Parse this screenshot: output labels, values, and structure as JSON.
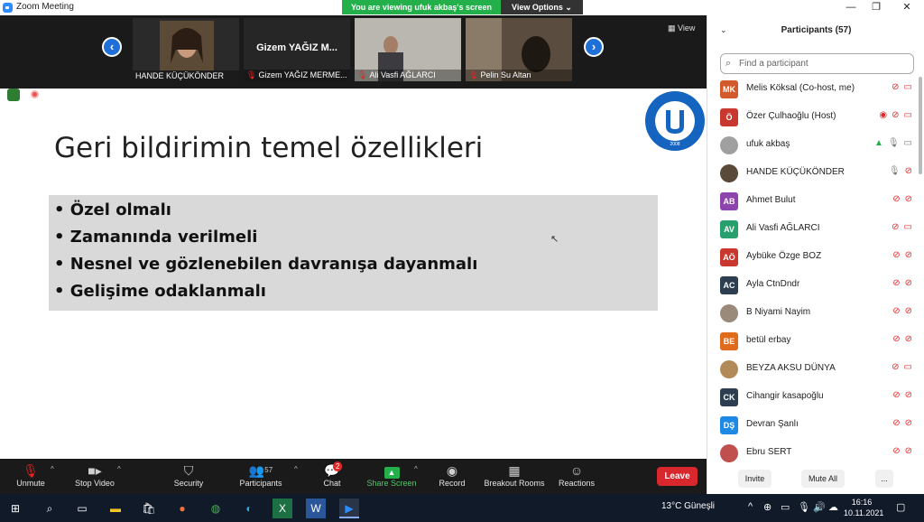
{
  "window": {
    "title": "Zoom Meeting",
    "minimize": "—",
    "maximize": "❐",
    "close": "✕"
  },
  "banner": {
    "message": "You are viewing ufuk akbaş's screen",
    "options": "View Options ⌄"
  },
  "video_strip": {
    "tiles": [
      {
        "name": "HANDE KÜÇÜKÖNDER",
        "muted": false
      },
      {
        "name": "Gizem YAĞIZ MERME...",
        "big_name": "Gizem YAĞIZ M...",
        "muted": true
      },
      {
        "name": "Ali Vasfi AĞLARCI",
        "muted": true
      },
      {
        "name": "Pelin Su Altan",
        "muted": true
      }
    ],
    "view_label": "View"
  },
  "slide": {
    "title": "Geri bildirimin temel özellikleri",
    "bullets": [
      "• Özel olmalı",
      "• Zamanında verilmeli",
      "• Nesnel ve gözlenebilen davranışa dayanmalı",
      "• Gelişime odaklanmalı"
    ],
    "logo_text": "BARTIN ÜNİVERSİTESİ",
    "logo_year": "2008"
  },
  "toolbar": {
    "unmute": "Unmute",
    "stop_video": "Stop Video",
    "security": "Security",
    "participants": "Participants",
    "participants_count": "57",
    "chat": "Chat",
    "chat_badge": "2",
    "share_screen": "Share Screen",
    "record": "Record",
    "breakout_rooms": "Breakout Rooms",
    "reactions": "Reactions",
    "leave": "Leave"
  },
  "panel": {
    "title": "Participants (57)",
    "search_placeholder": "Find a participant",
    "participants": [
      {
        "initials": "MK",
        "name": "Melis Köksal (Co-host, me)",
        "color": "#d2592a",
        "photo": false
      },
      {
        "initials": "Ö",
        "name": "Özer Çulhaoğlu (Host)",
        "color": "#c8382e",
        "photo": false
      },
      {
        "initials": "",
        "name": "ufuk akbaş",
        "color": "#a0a0a0",
        "photo": true
      },
      {
        "initials": "",
        "name": "HANDE KÜÇÜKÖNDER",
        "color": "#5a4a3a",
        "photo": true
      },
      {
        "initials": "AB",
        "name": "Ahmet Bulut",
        "color": "#8e44ad",
        "photo": false
      },
      {
        "initials": "AV",
        "name": "Ali Vasfi AĞLARCI",
        "color": "#27a06e",
        "photo": false
      },
      {
        "initials": "AÖ",
        "name": "Aybüke Özge BOZ",
        "color": "#c8382e",
        "photo": false
      },
      {
        "initials": "AC",
        "name": "Ayla CtnDndr",
        "color": "#2c3e50",
        "photo": false
      },
      {
        "initials": "",
        "name": "B Niyami Nayim",
        "color": "#9a8a7a",
        "photo": true
      },
      {
        "initials": "BE",
        "name": "betül erbay",
        "color": "#e06b1c",
        "photo": false
      },
      {
        "initials": "",
        "name": "BEYZA AKSU DÜNYA",
        "color": "#b28a5a",
        "photo": true
      },
      {
        "initials": "CK",
        "name": "Cihangir kasapoğlu",
        "color": "#2c3e50",
        "photo": false
      },
      {
        "initials": "DŞ",
        "name": "Devran Şanlı",
        "color": "#1e88e5",
        "photo": false
      },
      {
        "initials": "",
        "name": "Ebru SERT",
        "color": "#c0504d",
        "photo": true
      }
    ],
    "footer": {
      "invite": "Invite",
      "mute_all": "Mute All",
      "more": "..."
    }
  },
  "taskbar": {
    "weather": "13°C  Güneşli",
    "time": "16:16",
    "date": "10.11.2021"
  }
}
